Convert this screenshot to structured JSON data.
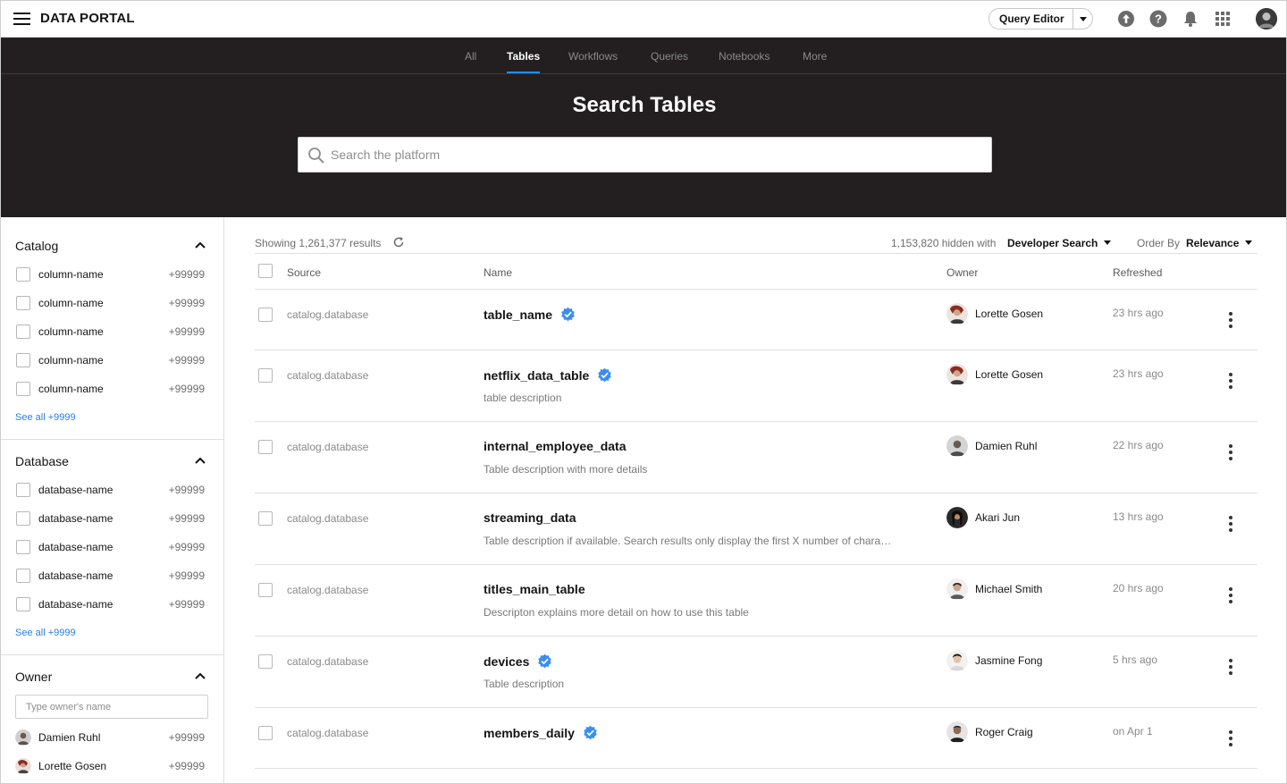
{
  "app": {
    "brand": "DATA PORTAL"
  },
  "topbar": {
    "query_editor_label": "Query Editor",
    "icons": [
      "hamburger-menu-icon",
      "upload-icon",
      "help-icon",
      "bell-icon",
      "apps-grid-icon",
      "user-avatar"
    ]
  },
  "nav_tabs": {
    "all": "All",
    "tables": "Tables",
    "workflows": "Workflows",
    "queries": "Queries",
    "notebooks": "Notebooks",
    "more": "More",
    "active": "Tables"
  },
  "hero": {
    "title": "Search Tables",
    "search_placeholder": "Search the platform"
  },
  "colors": {
    "header_bg": "#231f20",
    "accent": "#2b8cf0",
    "link": "#2b7de0",
    "verified": "#3b8ef0"
  },
  "sidebar": {
    "catalog": {
      "title": "Catalog",
      "items": [
        {
          "label": "column-name",
          "count": "+99999"
        },
        {
          "label": "column-name",
          "count": "+99999"
        },
        {
          "label": "column-name",
          "count": "+99999"
        },
        {
          "label": "column-name",
          "count": "+99999"
        },
        {
          "label": "column-name",
          "count": "+99999"
        }
      ],
      "see_all": "See all +9999"
    },
    "database": {
      "title": "Database",
      "items": [
        {
          "label": "database-name",
          "count": "+99999"
        },
        {
          "label": "database-name",
          "count": "+99999"
        },
        {
          "label": "database-name",
          "count": "+99999"
        },
        {
          "label": "database-name",
          "count": "+99999"
        },
        {
          "label": "database-name",
          "count": "+99999"
        }
      ],
      "see_all": "See all +9999"
    },
    "owner": {
      "title": "Owner",
      "input_placeholder": "Type owner's name",
      "items": [
        {
          "label": "Damien Ruhl",
          "count": "+99999"
        },
        {
          "label": "Lorette Gosen",
          "count": "+99999"
        }
      ]
    }
  },
  "results": {
    "showing": "Showing 1,261,377 results",
    "hidden_text": "1,153,820 hidden with",
    "hidden_filter": "Developer Search",
    "order_by_label": "Order By",
    "order_by_value": "Relevance",
    "columns": {
      "source": "Source",
      "name": "Name",
      "owner": "Owner",
      "refreshed": "Refreshed"
    },
    "rows": [
      {
        "source": "catalog.database",
        "name": "table_name",
        "verified": true,
        "description": "",
        "owner": "Lorette Gosen",
        "refreshed": "23 hrs ago"
      },
      {
        "source": "catalog.database",
        "name": "netflix_data_table",
        "verified": true,
        "description": "table description",
        "owner": "Lorette Gosen",
        "refreshed": "23 hrs ago"
      },
      {
        "source": "catalog.database",
        "name": "internal_employee_data",
        "verified": false,
        "description": "Table description with more details",
        "owner": "Damien Ruhl",
        "refreshed": "22 hrs ago"
      },
      {
        "source": "catalog.database",
        "name": "streaming_data",
        "verified": false,
        "description": "Table description if available. Search results only display the first X number of chara…",
        "owner": "Akari Jun",
        "refreshed": "13 hrs ago"
      },
      {
        "source": "catalog.database",
        "name": "titles_main_table",
        "verified": false,
        "description": "Descripton explains more detail on how to use this table",
        "owner": "Michael Smith",
        "refreshed": "20 hrs ago"
      },
      {
        "source": "catalog.database",
        "name": "devices",
        "verified": true,
        "description": "Table description",
        "owner": "Jasmine Fong",
        "refreshed": "5 hrs ago"
      },
      {
        "source": "catalog.database",
        "name": "members_daily",
        "verified": true,
        "description": "",
        "owner": "Roger Craig",
        "refreshed": "on Apr 1"
      }
    ]
  }
}
